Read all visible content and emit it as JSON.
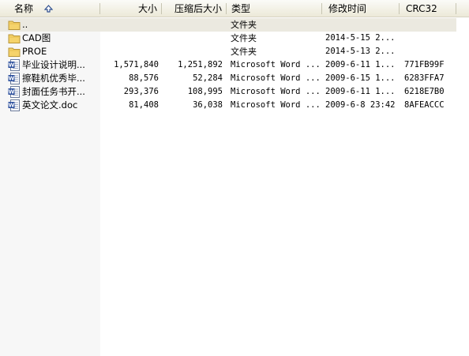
{
  "header": {
    "name": "名称",
    "size": "大小",
    "packed": "压缩后大小",
    "type": "类型",
    "modified": "修改时间",
    "crc": "CRC32",
    "sort_icon": "sort-ascending-arrow-icon"
  },
  "files": [
    {
      "name": "..",
      "size": "",
      "packed": "",
      "type": "文件夹",
      "modified": "",
      "crc": "",
      "icon": "folder-icon",
      "selected": true
    },
    {
      "name": "CAD图",
      "size": "",
      "packed": "",
      "type": "文件夹",
      "modified": "2014-5-15 2...",
      "crc": "",
      "icon": "folder-icon",
      "selected": false
    },
    {
      "name": "PROE",
      "size": "",
      "packed": "",
      "type": "文件夹",
      "modified": "2014-5-13 2...",
      "crc": "",
      "icon": "folder-icon",
      "selected": false
    },
    {
      "name": "毕业设计说明...",
      "size": "1,571,840",
      "packed": "1,251,892",
      "type": "Microsoft Word ...",
      "modified": "2009-6-11 1...",
      "crc": "771FB99F",
      "icon": "word-doc-icon",
      "selected": false
    },
    {
      "name": "擦鞋机优秀毕...",
      "size": "88,576",
      "packed": "52,284",
      "type": "Microsoft Word ...",
      "modified": "2009-6-15 1...",
      "crc": "6283FFA7",
      "icon": "word-doc-icon",
      "selected": false
    },
    {
      "name": "封面任务书开...",
      "size": "293,376",
      "packed": "108,995",
      "type": "Microsoft Word ...",
      "modified": "2009-6-11 1...",
      "crc": "6218E7B0",
      "icon": "word-doc-icon",
      "selected": false
    },
    {
      "name": "英文论文.doc",
      "size": "81,408",
      "packed": "36,038",
      "type": "Microsoft Word ...",
      "modified": "2009-6-8 23:42",
      "crc": "8AFEACCC",
      "icon": "word-doc-icon",
      "selected": false
    }
  ],
  "colors": {
    "selected_row": "#ebe9e0",
    "name_column_shade": "#f7f7f7",
    "folder": "#f5d36b",
    "word_icon": "#2b4f9e"
  }
}
